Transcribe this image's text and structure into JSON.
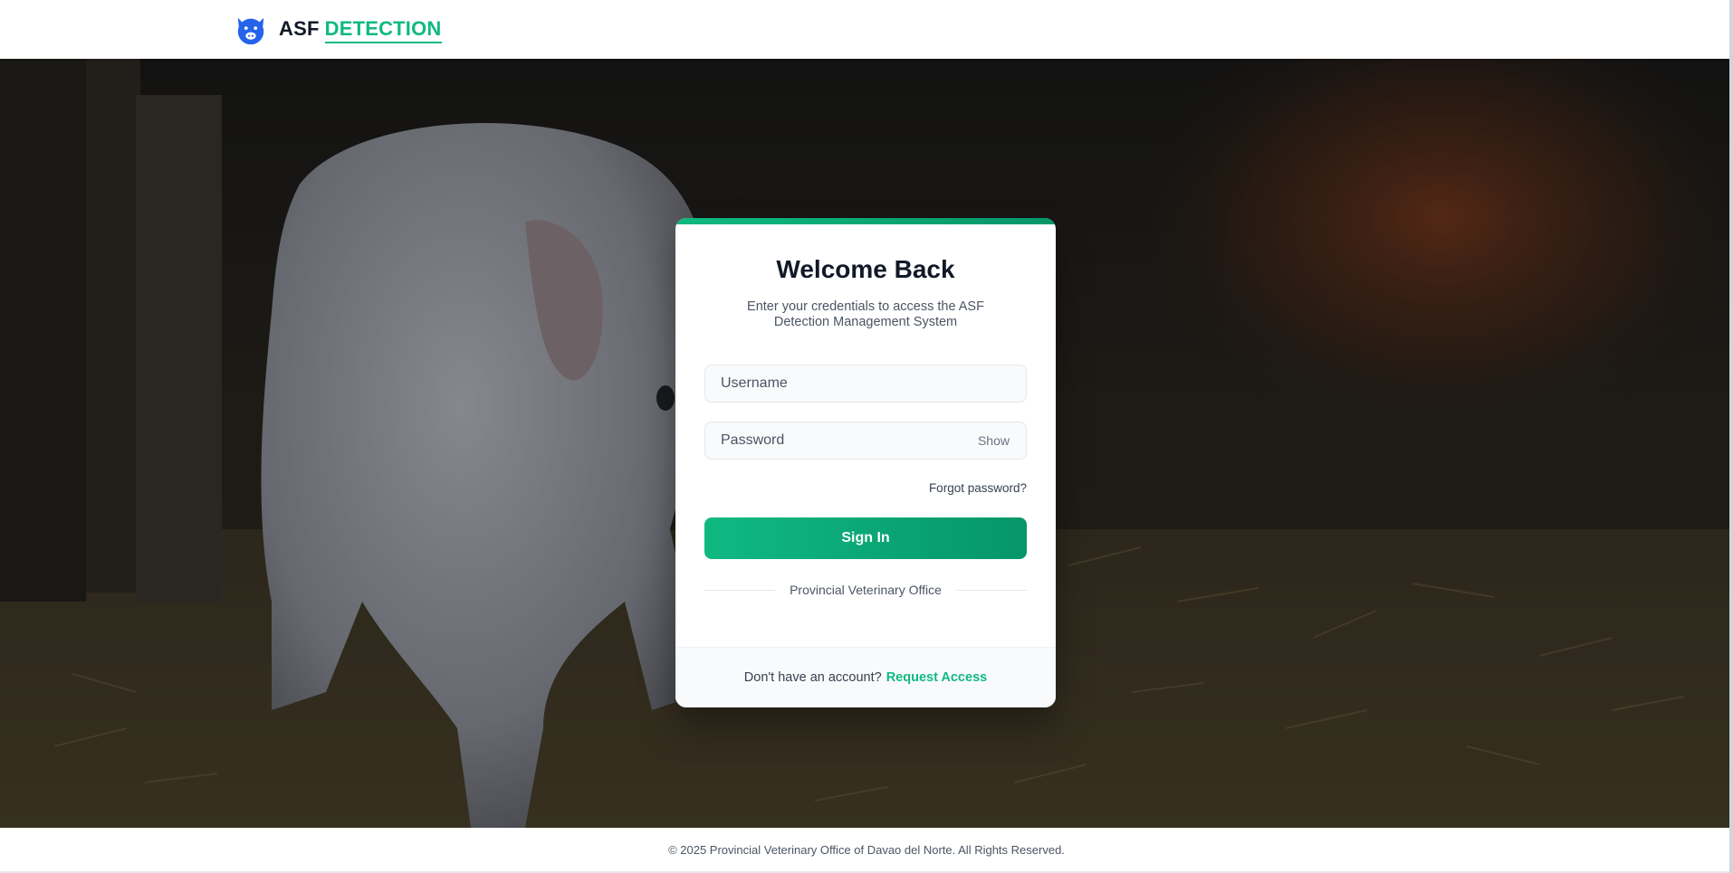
{
  "header": {
    "brand_prefix": "ASF",
    "brand_accent": "DETECTION",
    "logo_icon": "pig-icon"
  },
  "login": {
    "title": "Welcome Back",
    "subtitle": "Enter your credentials to access the ASF Detection Management System",
    "username_placeholder": "Username",
    "username_value": "",
    "password_placeholder": "Password",
    "password_value": "",
    "show_label": "Show",
    "forgot_label": "Forgot password?",
    "signin_label": "Sign In",
    "divider_text": "Provincial Veterinary Office",
    "footer_prompt": "Don't have an account?",
    "request_access_label": "Request Access"
  },
  "footer": {
    "copyright": "© 2025 Provincial Veterinary Office of Davao del Norte. All Rights Reserved."
  },
  "colors": {
    "accent": "#10b981",
    "accent_dark": "#059669",
    "logo_blue": "#2563eb",
    "text_dark": "#111827"
  }
}
